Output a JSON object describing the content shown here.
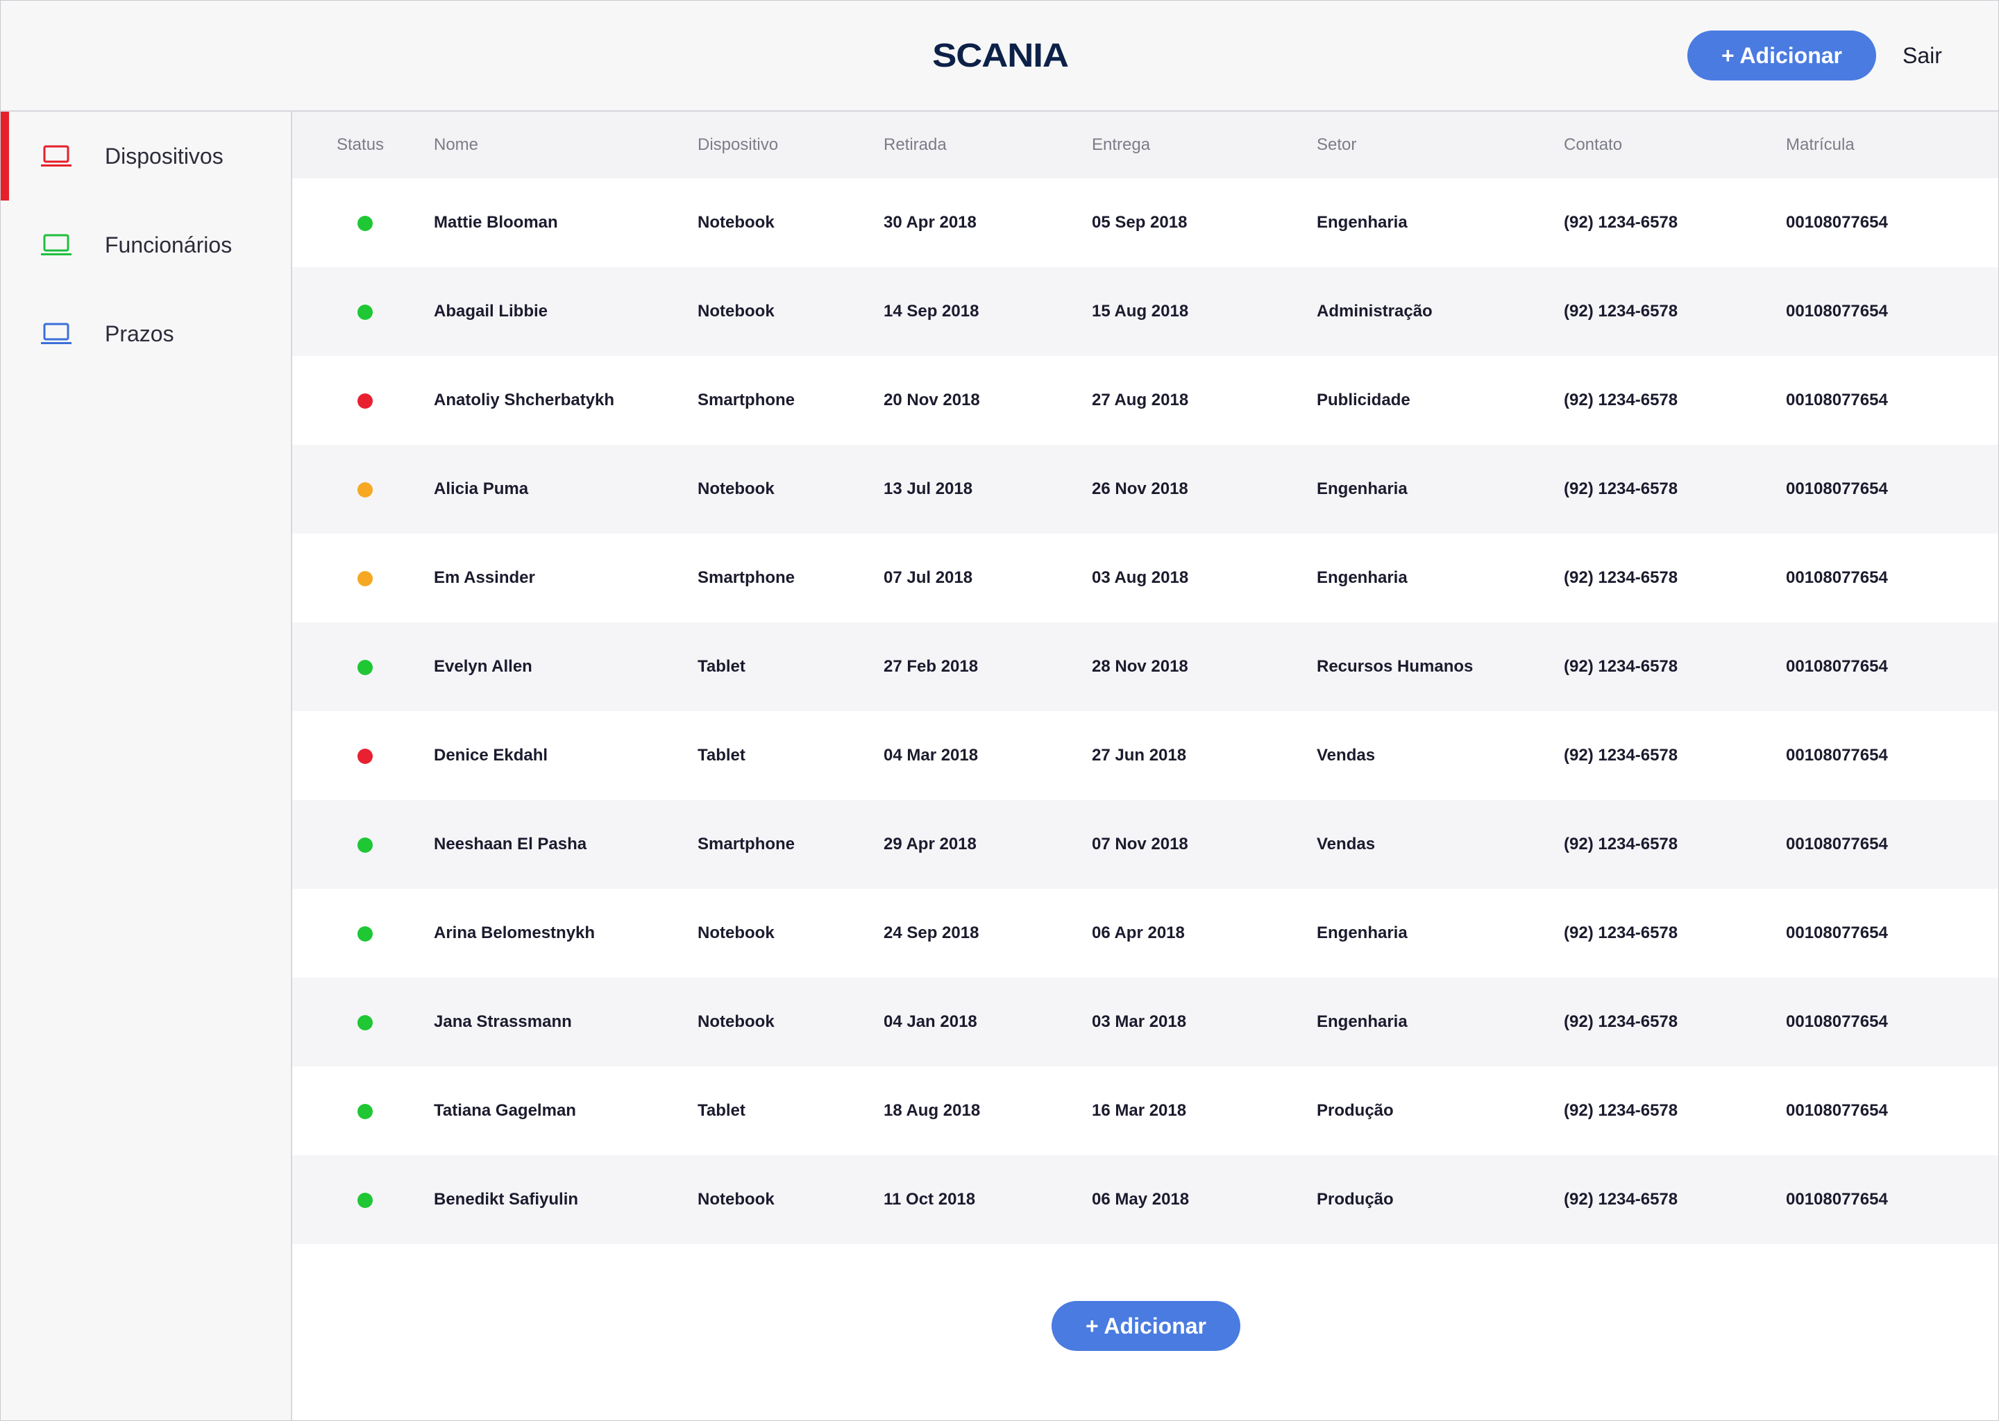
{
  "header": {
    "logo_text": "SCANIA",
    "add_label": "+ Adicionar",
    "logout_label": "Sair"
  },
  "sidebar": {
    "items": [
      {
        "label": "Dispositivos",
        "icon": "laptop-icon",
        "color": "#e5202a",
        "active": true
      },
      {
        "label": "Funcionários",
        "icon": "laptop-icon",
        "color": "#1fbf3a",
        "active": false
      },
      {
        "label": "Prazos",
        "icon": "laptop-icon",
        "color": "#3b6fd8",
        "active": false
      }
    ]
  },
  "colors": {
    "accent": "#4a7be0",
    "status_ok": "#1ec733",
    "status_late": "#e8202f",
    "status_warning": "#f7a823"
  },
  "table": {
    "columns": [
      "Status",
      "Nome",
      "Dispositivo",
      "Retirada",
      "Entrega",
      "Setor",
      "Contato",
      "Matrícula"
    ],
    "rows": [
      {
        "status": "ok",
        "nome": "Mattie Blooman",
        "dispositivo": "Notebook",
        "retirada": "30 Apr 2018",
        "entrega": "05 Sep 2018",
        "setor": "Engenharia",
        "contato": "(92) 1234-6578",
        "matricula": "00108077654"
      },
      {
        "status": "ok",
        "nome": "Abagail Libbie",
        "dispositivo": "Notebook",
        "retirada": "14 Sep 2018",
        "entrega": "15 Aug 2018",
        "setor": "Administração",
        "contato": "(92) 1234-6578",
        "matricula": "00108077654"
      },
      {
        "status": "late",
        "nome": "Anatoliy Shcherbatykh",
        "dispositivo": "Smartphone",
        "retirada": "20 Nov 2018",
        "entrega": "27 Aug 2018",
        "setor": "Publicidade",
        "contato": "(92) 1234-6578",
        "matricula": "00108077654"
      },
      {
        "status": "warning",
        "nome": "Alicia Puma",
        "dispositivo": "Notebook",
        "retirada": "13 Jul 2018",
        "entrega": "26 Nov 2018",
        "setor": "Engenharia",
        "contato": "(92) 1234-6578",
        "matricula": "00108077654"
      },
      {
        "status": "warning",
        "nome": "Em Assinder",
        "dispositivo": "Smartphone",
        "retirada": "07 Jul 2018",
        "entrega": "03 Aug 2018",
        "setor": "Engenharia",
        "contato": "(92) 1234-6578",
        "matricula": "00108077654"
      },
      {
        "status": "ok",
        "nome": "Evelyn Allen",
        "dispositivo": "Tablet",
        "retirada": "27 Feb 2018",
        "entrega": "28 Nov 2018",
        "setor": "Recursos Humanos",
        "contato": "(92) 1234-6578",
        "matricula": "00108077654"
      },
      {
        "status": "late",
        "nome": "Denice Ekdahl",
        "dispositivo": "Tablet",
        "retirada": "04 Mar 2018",
        "entrega": "27 Jun 2018",
        "setor": "Vendas",
        "contato": "(92) 1234-6578",
        "matricula": "00108077654"
      },
      {
        "status": "ok",
        "nome": "Neeshaan El Pasha",
        "dispositivo": "Smartphone",
        "retirada": "29 Apr 2018",
        "entrega": "07 Nov 2018",
        "setor": "Vendas",
        "contato": "(92) 1234-6578",
        "matricula": "00108077654"
      },
      {
        "status": "ok",
        "nome": "Arina Belomestnykh",
        "dispositivo": "Notebook",
        "retirada": "24 Sep 2018",
        "entrega": "06 Apr 2018",
        "setor": "Engenharia",
        "contato": "(92) 1234-6578",
        "matricula": "00108077654"
      },
      {
        "status": "ok",
        "nome": "Jana Strassmann",
        "dispositivo": "Notebook",
        "retirada": "04 Jan 2018",
        "entrega": "03 Mar 2018",
        "setor": "Engenharia",
        "contato": "(92) 1234-6578",
        "matricula": "00108077654"
      },
      {
        "status": "ok",
        "nome": "Tatiana Gagelman",
        "dispositivo": "Tablet",
        "retirada": "18 Aug 2018",
        "entrega": "16 Mar 2018",
        "setor": "Produção",
        "contato": "(92) 1234-6578",
        "matricula": "00108077654"
      },
      {
        "status": "ok",
        "nome": "Benedikt Safiyulin",
        "dispositivo": "Notebook",
        "retirada": "11 Oct 2018",
        "entrega": "06 May 2018",
        "setor": "Produção",
        "contato": "(92) 1234-6578",
        "matricula": "00108077654"
      }
    ]
  },
  "footer": {
    "add_label": "+ Adicionar"
  }
}
